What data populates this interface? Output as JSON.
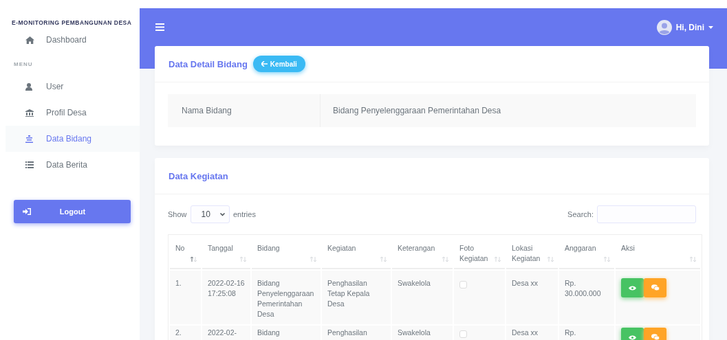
{
  "sidebar": {
    "brand": "E-MONITORING PEMBANGUNAN DESA",
    "top_items": [
      {
        "label": "Dashboard",
        "selected": false
      }
    ],
    "section_heading": "MENU",
    "menu_items": [
      {
        "label": "User",
        "selected": false
      },
      {
        "label": "Profil Desa",
        "selected": false
      },
      {
        "label": "Data Bidang",
        "selected": true
      },
      {
        "label": "Data Berita",
        "selected": false
      }
    ],
    "logout_button": "Logout"
  },
  "topbar": {
    "user_name": "Hi, Dini"
  },
  "detail_card": {
    "title": "Data Detail Bidang",
    "back_button": "Kembali",
    "fields": [
      {
        "label": "Nama Bidang",
        "value": "Bidang Penyelenggaraan Pemerintahan Desa"
      }
    ]
  },
  "kegiatan_card": {
    "title": "Data Kegiatan",
    "length_menu": {
      "prefix": "Show",
      "value": "10",
      "suffix": "entries"
    },
    "search": {
      "label": "Search:"
    },
    "table": {
      "columns": [
        {
          "label": "No",
          "kind": "text",
          "sorted": true
        },
        {
          "label": "Tanggal",
          "kind": "text",
          "sorted": false
        },
        {
          "label": "Bidang",
          "kind": "text",
          "sorted": false
        },
        {
          "label": "Kegiatan",
          "kind": "text",
          "sorted": false
        },
        {
          "label": "Keterangan",
          "kind": "text",
          "sorted": false
        },
        {
          "label": "Foto Kegiatan",
          "kind": "photo",
          "sorted": false
        },
        {
          "label": "Lokasi Kegiatan",
          "kind": "text",
          "sorted": false
        },
        {
          "label": "Anggaran",
          "kind": "text",
          "sorted": false
        },
        {
          "label": "Aksi",
          "kind": "actions",
          "sorted": false
        }
      ],
      "rows": [
        {
          "cells": [
            "1.",
            "2022-02-16 17:25:08",
            "Bidang Penyelenggaraan Pemerintahan Desa",
            "Penghasilan Tetap Kepala Desa",
            "Swakelola",
            "",
            "Desa xx",
            "Rp. 30.000.000"
          ]
        },
        {
          "cells": [
            "2.",
            "2022-02-",
            "Bidang",
            "Penghasilan",
            "Swakelola",
            "",
            "Desa xx",
            "Rp."
          ]
        }
      ]
    }
  }
}
